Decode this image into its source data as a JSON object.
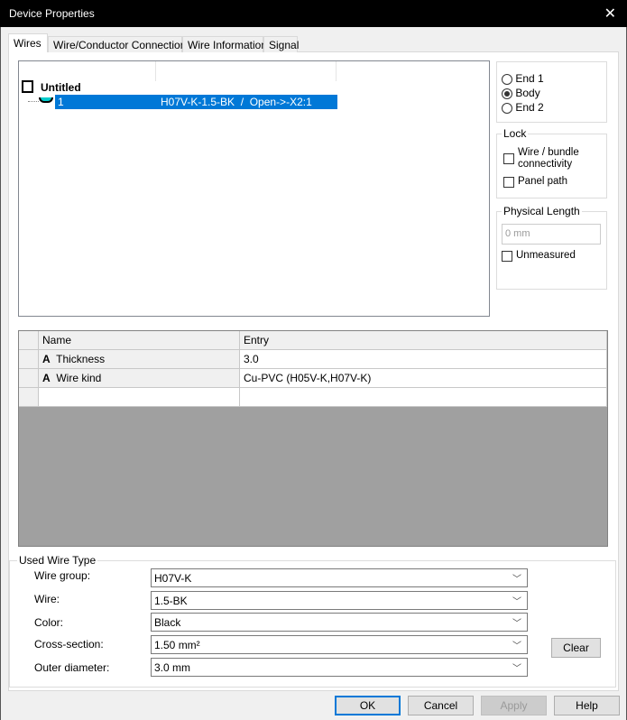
{
  "window": {
    "title": "Device Properties",
    "close": "✕"
  },
  "tabs": [
    "Wires",
    "Wire/Conductor Connections",
    "Wire Information",
    "Signal"
  ],
  "tree": {
    "root": "Untitled",
    "row": {
      "id": "1",
      "desc": "H07V-K-1.5-BK  /  Open->-X2:1"
    }
  },
  "position": {
    "options": [
      "End 1",
      "Body",
      "End 2"
    ],
    "selected": "Body"
  },
  "lock": {
    "title": "Lock",
    "wire_bundle": "Wire / bundle",
    "connectivity": "connectivity",
    "panel_path": "Panel path"
  },
  "physical_length": {
    "title": "Physical Length",
    "placeholder": "0 mm",
    "unmeasured": "Unmeasured"
  },
  "grid": {
    "headers": [
      "Name",
      "Entry"
    ],
    "rows": [
      {
        "name": "Thickness",
        "entry": "3.0"
      },
      {
        "name": "Wire kind",
        "entry": "Cu-PVC (H05V-K,H07V-K)"
      }
    ],
    "attr_icon": "A"
  },
  "used_wire_type": {
    "title": "Used Wire Type",
    "fields": [
      {
        "label": "Wire group:",
        "value": "H07V-K"
      },
      {
        "label": "Wire:",
        "value": "1.5-BK"
      },
      {
        "label": "Color:",
        "value": "Black"
      },
      {
        "label": "Cross-section:",
        "value": "1.50 mm²"
      },
      {
        "label": "Outer diameter:",
        "value": "3.0 mm"
      }
    ],
    "clear": "Clear"
  },
  "buttons": {
    "ok": "OK",
    "cancel": "Cancel",
    "apply": "Apply",
    "help": "Help"
  }
}
